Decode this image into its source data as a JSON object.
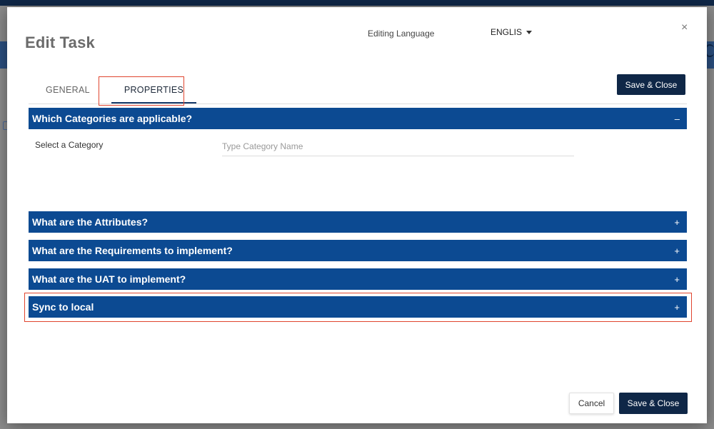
{
  "modal": {
    "title": "Edit Task",
    "close_glyph": "×"
  },
  "language": {
    "label": "Editing Language",
    "selected": "ENGLIS"
  },
  "tabs": [
    {
      "label": "GENERAL"
    },
    {
      "label": "PROPERTIES"
    }
  ],
  "buttons": {
    "save_close": "Save & Close",
    "cancel": "Cancel"
  },
  "sections": [
    {
      "title": "Which Categories are applicable?",
      "sign": "–"
    },
    {
      "title": "What are the Attributes?",
      "sign": "+"
    },
    {
      "title": "What are the Requirements to implement?",
      "sign": "+"
    },
    {
      "title": "What are the UAT to implement?",
      "sign": "+"
    },
    {
      "title": "Sync to local",
      "sign": "+"
    }
  ],
  "category": {
    "label": "Select a Category",
    "placeholder": "Type Category Name"
  },
  "colors": {
    "accent": "#0c4a92",
    "primary_button": "#0f2747",
    "highlight": "#e0452f"
  }
}
